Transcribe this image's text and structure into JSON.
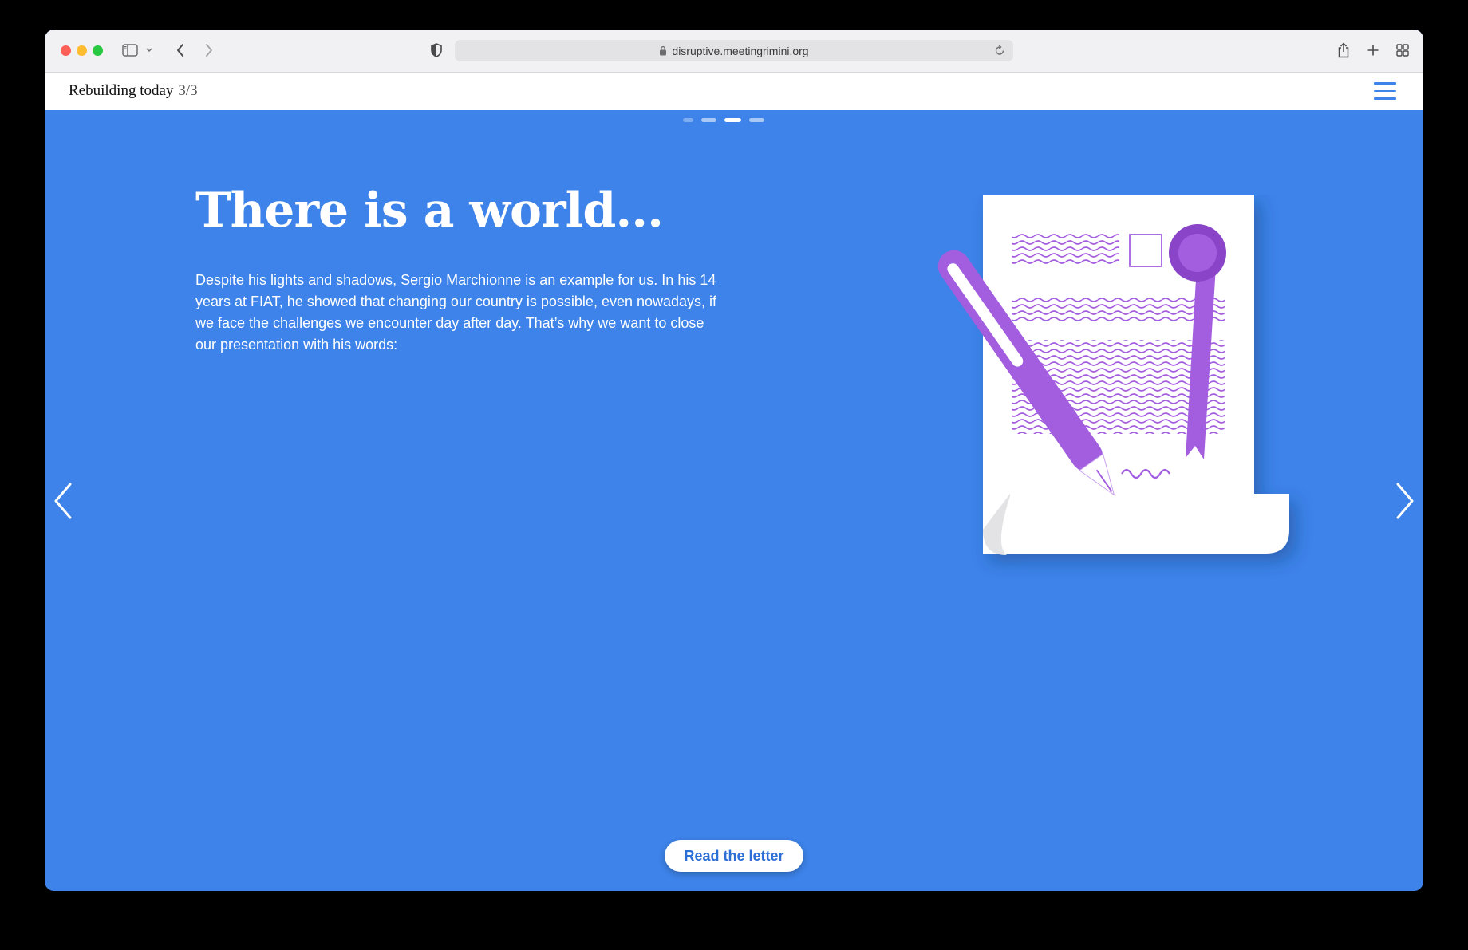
{
  "browser": {
    "url": "disruptive.meetingrimini.org"
  },
  "site": {
    "section_title": "Rebuilding today",
    "section_count": "3/3"
  },
  "slide": {
    "headline": "There is a world...",
    "body": "Despite his lights and shadows, Sergio Marchionne is an example for us. In his 14 years at FIAT, he showed that changing our country is possible, even nowadays, if we face the challenges we encounter day after day. That’s why we want to close our presentation with his words:",
    "cta_label": "Read the letter",
    "pagination_total": 4,
    "pagination_active_index": 3
  },
  "colors": {
    "background": "#3d83e9",
    "accent_purple": "#a35ee0",
    "button_text": "#2c6fd6"
  },
  "icons": [
    "sidebar-icon",
    "chevron-down-icon",
    "back-icon",
    "forward-icon",
    "privacy-shield-icon",
    "lock-icon",
    "reload-icon",
    "share-icon",
    "new-tab-icon",
    "tab-overview-icon",
    "hamburger-menu-icon",
    "chevron-left-icon",
    "chevron-right-icon"
  ]
}
